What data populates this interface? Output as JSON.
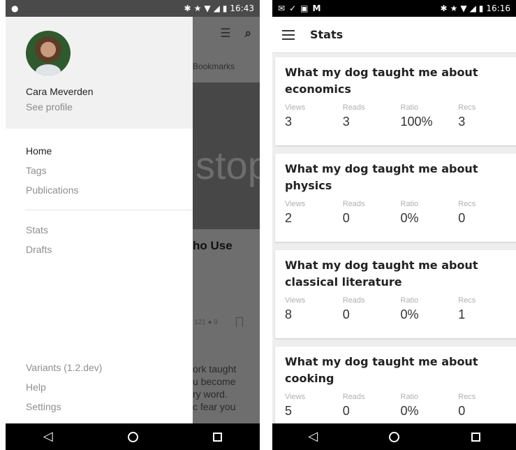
{
  "left": {
    "status": {
      "notification_icon": "android-icon",
      "time": "16:43"
    },
    "background_app": {
      "tab_label": "Bookmarks",
      "hero_text": "stop",
      "headline": "ho Use",
      "meta": "121",
      "meta2": "9",
      "body_lines": [
        "ork taught",
        "u become",
        "ry word.",
        "c fear you"
      ]
    },
    "drawer": {
      "user_name": "Cara Meverden",
      "see_profile": "See profile",
      "nav_primary": [
        "Home",
        "Tags",
        "Publications"
      ],
      "nav_secondary": [
        "Stats",
        "Drafts"
      ],
      "nav_footer": [
        "Variants (1.2.dev)",
        "Help",
        "Settings"
      ]
    }
  },
  "right": {
    "status": {
      "time": "16:16"
    },
    "appbar": {
      "title": "Stats"
    },
    "labels": {
      "views": "Views",
      "reads": "Reads",
      "ratio": "Ratio",
      "recs": "Recs"
    },
    "stories": [
      {
        "title_line1": "What my dog taught me about",
        "title_line2": "economics",
        "views": "3",
        "reads": "3",
        "ratio": "100%",
        "recs": "3"
      },
      {
        "title_line1": "What my dog taught me about",
        "title_line2": "physics",
        "views": "2",
        "reads": "0",
        "ratio": "0%",
        "recs": "0"
      },
      {
        "title_line1": "What my dog taught me about",
        "title_line2": "classical literature",
        "views": "8",
        "reads": "0",
        "ratio": "0%",
        "recs": "1"
      },
      {
        "title_line1": "What my dog taught me about",
        "title_line2": "cooking",
        "views": "5",
        "reads": "0",
        "ratio": "0%",
        "recs": "0"
      }
    ]
  }
}
